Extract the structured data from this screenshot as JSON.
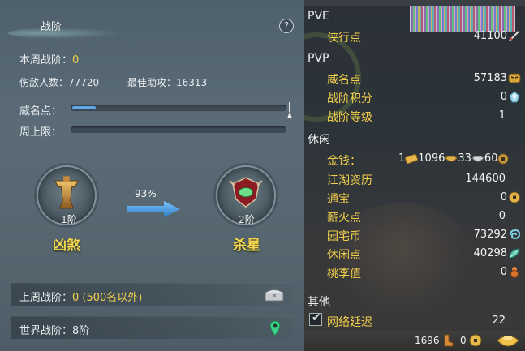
{
  "left": {
    "tab_title": "战阶",
    "help_label": "?",
    "weekly_rank_label": "本周战阶：",
    "weekly_rank_value": "0",
    "kills_label": "伤敌人数：",
    "kills_value": "77720",
    "best_assist_label": "最佳助攻：",
    "best_assist_value": "16313",
    "prestige_label": "威名点：",
    "prestige_fill_ratio": 0.11,
    "weekly_cap_label": "周上限：",
    "weekly_cap_fill_ratio": 0,
    "current_rank": {
      "level": "1阶",
      "name": "凶煞"
    },
    "next_rank": {
      "level": "2阶",
      "name": "杀星"
    },
    "progress_percent": "93%",
    "last_week_label": "上周战阶：",
    "last_week_value": "0 (500名以外)",
    "world_rank_label": "世界战阶：",
    "world_rank_value": "8阶"
  },
  "right": {
    "pve_header": "PVE",
    "pvp_header": "PVP",
    "leisure_header": "休闲",
    "other_header": "其他",
    "pve": [
      {
        "label": "侠行点",
        "value": "41100",
        "icon": "sword-icon"
      }
    ],
    "pvp": [
      {
        "label": "威名点",
        "value": "57183",
        "icon": "tiger-mask-icon"
      },
      {
        "label": "战阶积分",
        "value": "0",
        "icon": "crystal-icon"
      },
      {
        "label": "战阶等级",
        "value": "1",
        "icon": ""
      }
    ],
    "money": {
      "label": "金钱：",
      "gold": "1",
      "silver_ingot": "1096",
      "silver": "33",
      "copper": "60"
    },
    "leisure": [
      {
        "label": "江湖资历",
        "value": "144600",
        "icon": ""
      },
      {
        "label": "通宝",
        "value": "0",
        "icon": "coin-icon"
      },
      {
        "label": "薪火点",
        "value": "0",
        "icon": ""
      },
      {
        "label": "园宅币",
        "value": "73292",
        "icon": "swirl-coin-icon"
      },
      {
        "label": "休闲点",
        "value": "40298",
        "icon": "leaf-icon"
      },
      {
        "label": "桃李值",
        "value": "0",
        "icon": "gourd-icon"
      }
    ],
    "network_latency_label": "网络延迟",
    "network_latency_value": "22",
    "footer_value_1": "1696",
    "footer_value_2": "0"
  },
  "colors": {
    "label_gold": "#f2cf4c",
    "progress_blue": "#5fa9e6",
    "rank_name_gold": "#f5d84f"
  }
}
